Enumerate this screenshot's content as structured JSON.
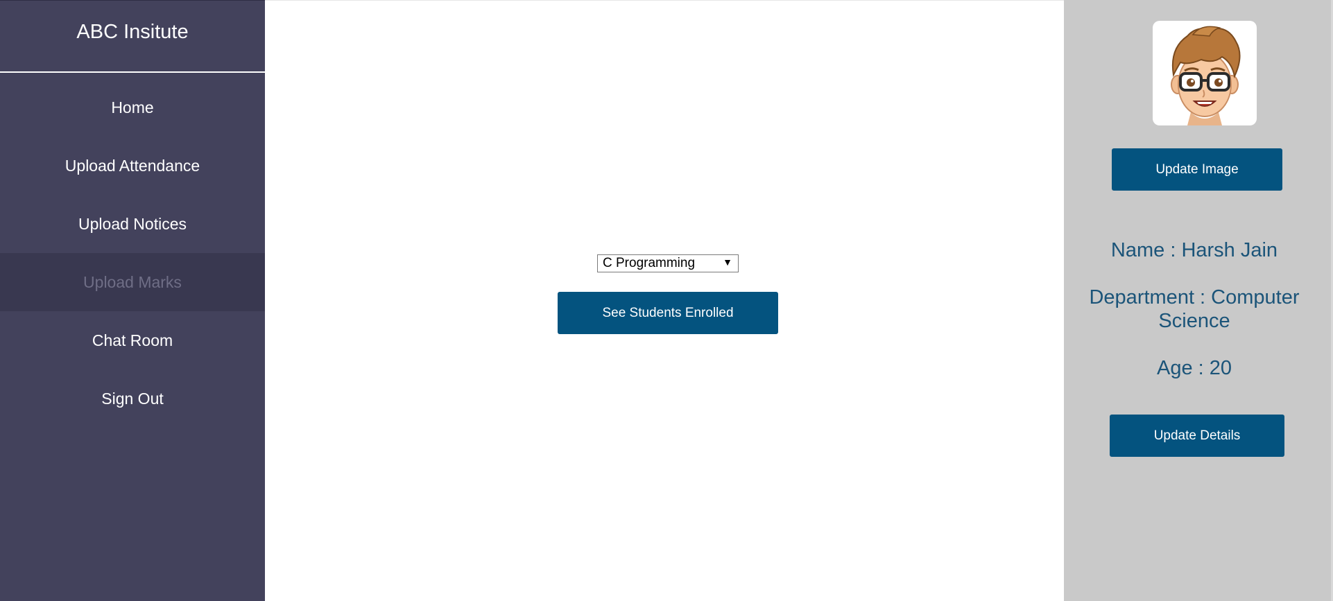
{
  "brand": {
    "title": "ABC Insitute"
  },
  "nav": {
    "items": [
      {
        "label": "Home"
      },
      {
        "label": "Upload Attendance"
      },
      {
        "label": "Upload Notices"
      },
      {
        "label": "Upload Marks"
      },
      {
        "label": "Chat Room"
      },
      {
        "label": "Sign Out"
      }
    ],
    "active": "Upload Marks"
  },
  "main": {
    "course_select": {
      "value": "C Programming"
    },
    "see_students_label": "See Students Enrolled"
  },
  "profile": {
    "update_image_label": "Update Image",
    "name": "Name : Harsh Jain",
    "department": "Department : Computer Science",
    "age": "Age : 20",
    "update_details_label": "Update Details"
  },
  "colors": {
    "sidebar": "#43425c",
    "sidebar_active": "#393850",
    "button": "#04537f",
    "profile_bg": "#c9c9c9",
    "profile_text": "#1b5479"
  },
  "icons": {
    "avatar": "cartoon-boy-with-glasses-avatar",
    "select_arrow": "dropdown-arrow-icon"
  }
}
